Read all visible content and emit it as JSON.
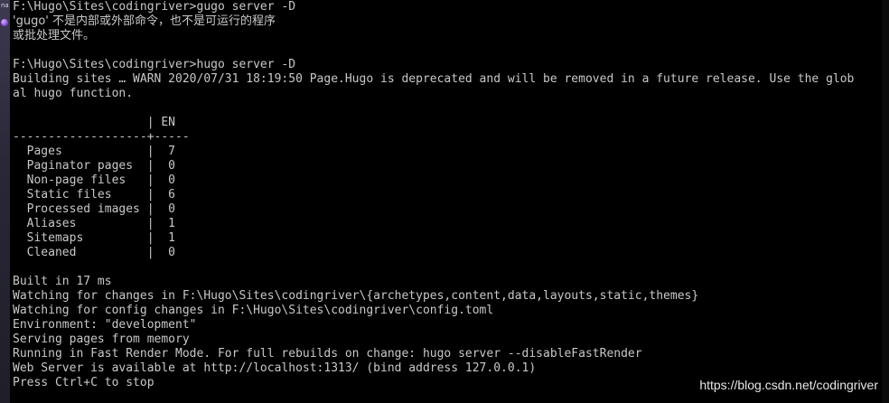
{
  "left_strip": {
    "glyph": "nac"
  },
  "console": {
    "lines": [
      {
        "text": "F:\\Hugo\\Sites\\codingriver>gugo server -D",
        "cjk": false
      },
      {
        "text": "'gugo' 不是内部或外部命令，也不是可运行的程序",
        "cjk": true
      },
      {
        "text": "或批处理文件。",
        "cjk": true
      },
      {
        "text": "",
        "cjk": false
      },
      {
        "text": "F:\\Hugo\\Sites\\codingriver>hugo server -D",
        "cjk": false
      },
      {
        "text": "Building sites … WARN 2020/07/31 18:19:50 Page.Hugo is deprecated and will be removed in a future release. Use the glob",
        "cjk": false
      },
      {
        "text": "al hugo function.",
        "cjk": false
      },
      {
        "text": "",
        "cjk": false
      },
      {
        "text": "                   | EN",
        "cjk": false
      },
      {
        "text": "-------------------+-----",
        "cjk": false
      },
      {
        "text": "  Pages            |  7",
        "cjk": false
      },
      {
        "text": "  Paginator pages  |  0",
        "cjk": false
      },
      {
        "text": "  Non-page files   |  0",
        "cjk": false
      },
      {
        "text": "  Static files     |  6",
        "cjk": false
      },
      {
        "text": "  Processed images |  0",
        "cjk": false
      },
      {
        "text": "  Aliases          |  1",
        "cjk": false
      },
      {
        "text": "  Sitemaps         |  1",
        "cjk": false
      },
      {
        "text": "  Cleaned          |  0",
        "cjk": false
      },
      {
        "text": "",
        "cjk": false
      },
      {
        "text": "Built in 17 ms",
        "cjk": false
      },
      {
        "text": "Watching for changes in F:\\Hugo\\Sites\\codingriver\\{archetypes,content,data,layouts,static,themes}",
        "cjk": false
      },
      {
        "text": "Watching for config changes in F:\\Hugo\\Sites\\codingriver\\config.toml",
        "cjk": false
      },
      {
        "text": "Environment: \"development\"",
        "cjk": false
      },
      {
        "text": "Serving pages from memory",
        "cjk": false
      },
      {
        "text": "Running in Fast Render Mode. For full rebuilds on change: hugo server --disableFastRender",
        "cjk": false
      },
      {
        "text": "Web Server is available at http://localhost:1313/ (bind address 127.0.0.1)",
        "cjk": false
      },
      {
        "text": "Press Ctrl+C to stop",
        "cjk": false
      }
    ]
  },
  "watermark": "https://blog.csdn.net/codingriver",
  "colors": {
    "background": "#000000",
    "text": "#c8c8c8",
    "watermark": "#e6e6e6"
  }
}
